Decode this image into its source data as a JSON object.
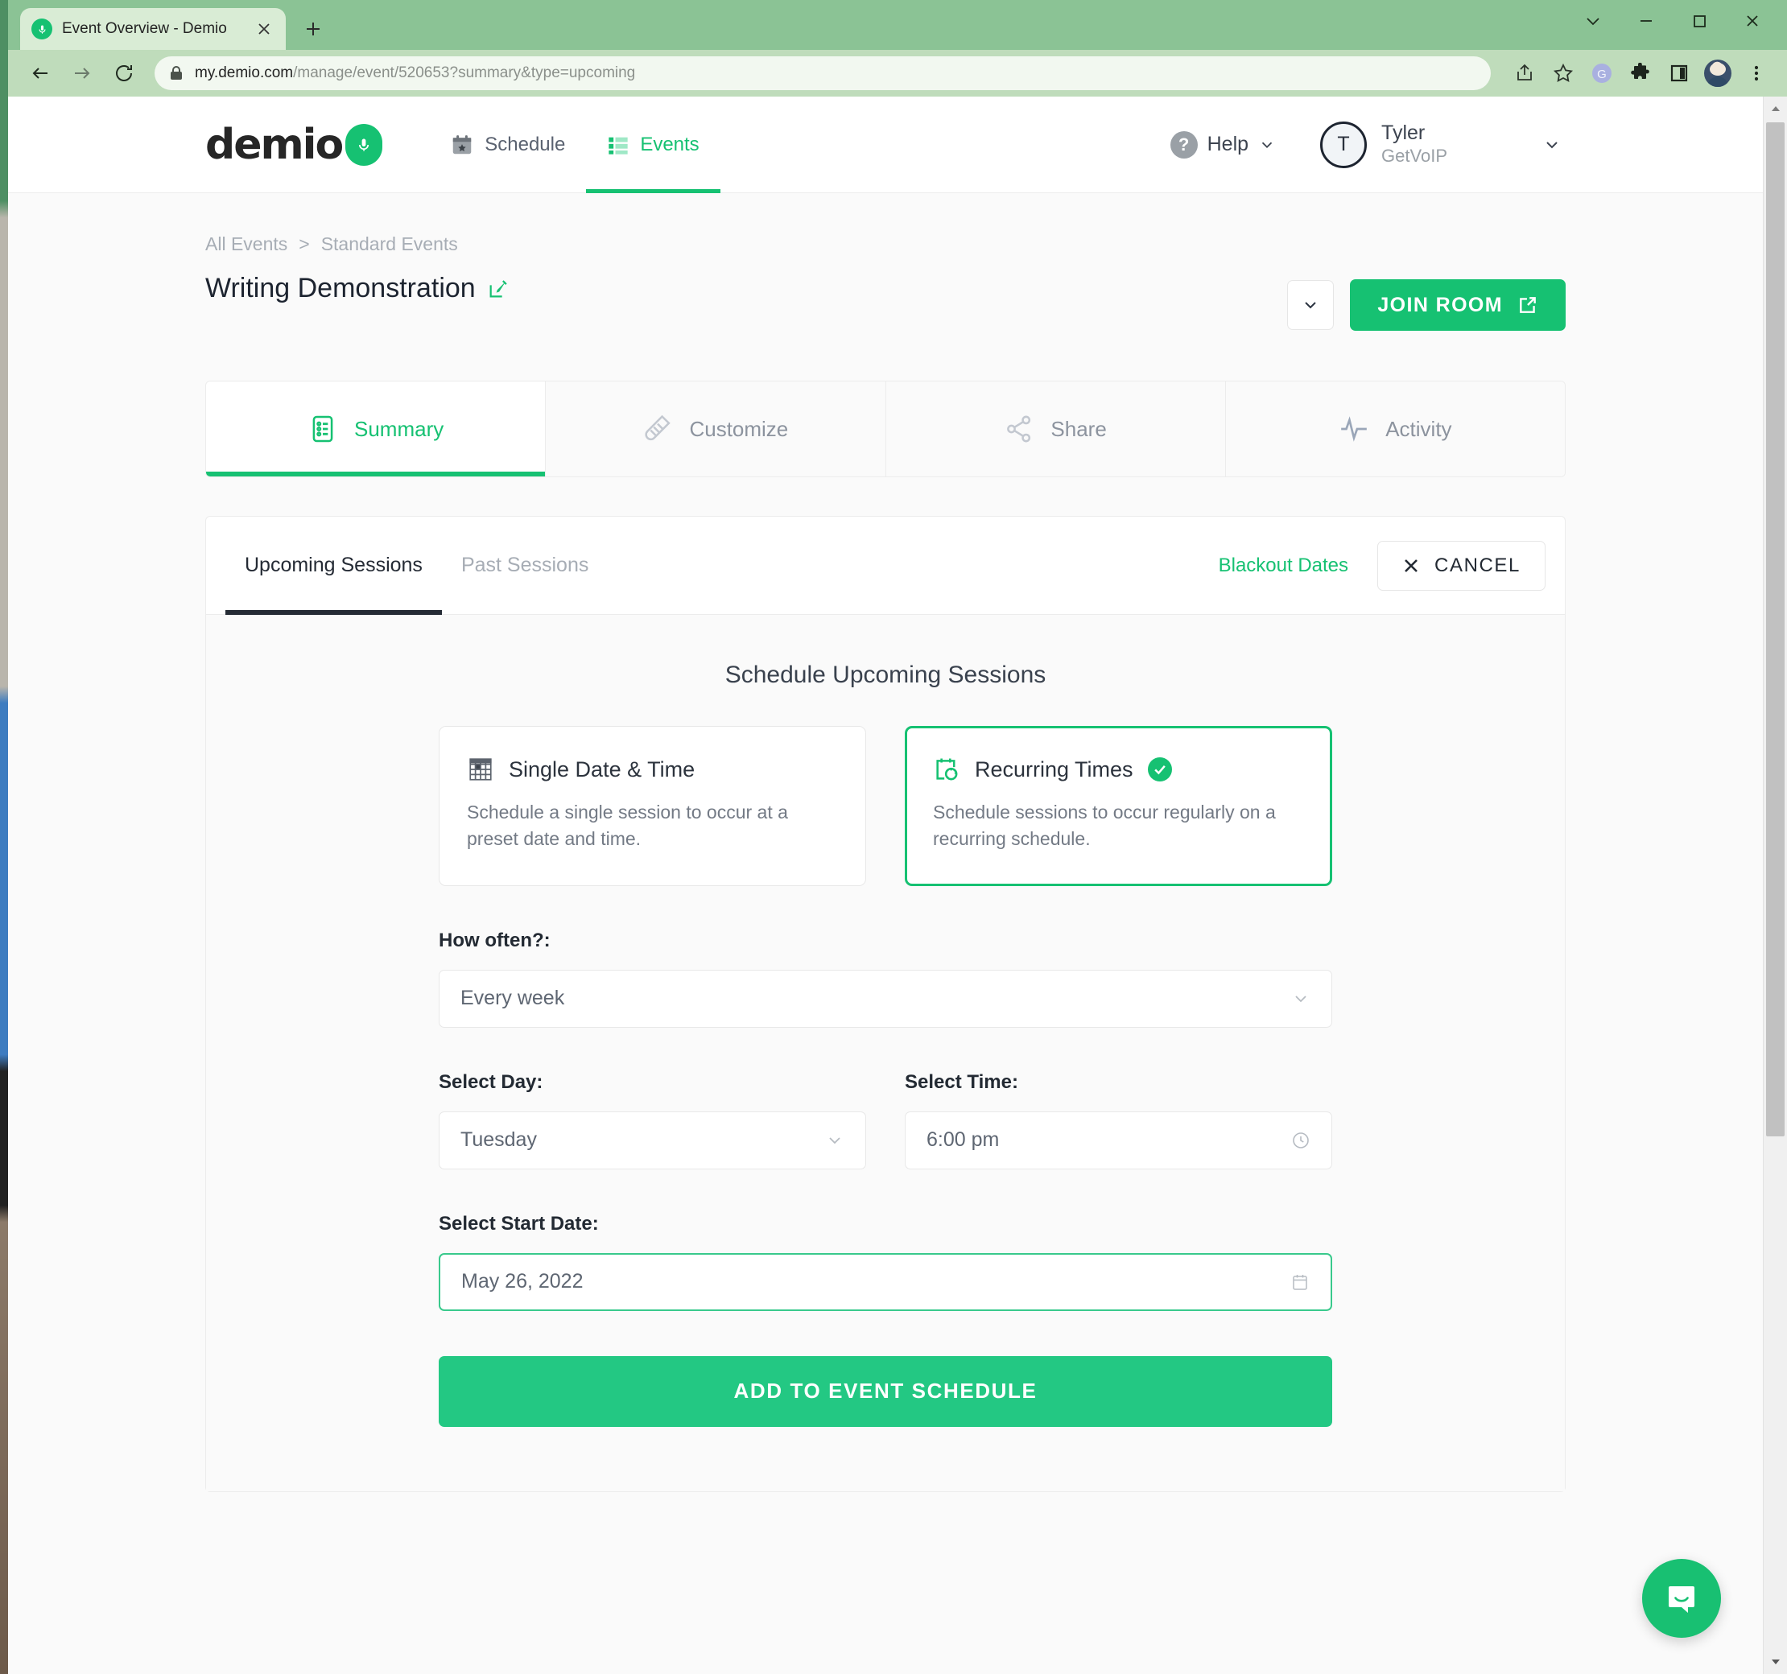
{
  "browser": {
    "tab": {
      "title": "Event Overview - Demio",
      "favicon": "demio-mic-icon",
      "close": "×"
    },
    "new_tab_label": "+",
    "url_main": "my.demio.com",
    "url_rest": "/manage/event/520653?summary&type=upcoming",
    "window_controls": {
      "minimize": "—",
      "maximize": "□",
      "close": "✕",
      "expand": "⌄"
    }
  },
  "app": {
    "logo_text": "demio",
    "nav": [
      {
        "label": "Schedule",
        "icon": "calendar-star-icon",
        "active": false
      },
      {
        "label": "Events",
        "icon": "list-icon",
        "active": true
      }
    ],
    "help_label": "Help",
    "help_badge": "?",
    "user": {
      "initial": "T",
      "name": "Tyler",
      "org": "GetVoIP"
    }
  },
  "breadcrumb": {
    "first": "All Events",
    "sep": ">",
    "second": "Standard Events"
  },
  "page_title": "Writing Demonstration",
  "actions": {
    "dropdown_caret": "⌄",
    "join_room": "JOIN ROOM"
  },
  "tabs": [
    {
      "label": "Summary",
      "icon": "summary-list-icon",
      "active": true
    },
    {
      "label": "Customize",
      "icon": "brush-icon",
      "active": false
    },
    {
      "label": "Share",
      "icon": "share-nodes-icon",
      "active": false
    },
    {
      "label": "Activity",
      "icon": "pulse-icon",
      "active": false
    }
  ],
  "panel": {
    "sub_tabs": [
      {
        "label": "Upcoming Sessions",
        "active": true
      },
      {
        "label": "Past Sessions",
        "active": false
      }
    ],
    "blackout_dates": "Blackout Dates",
    "cancel": "CANCEL",
    "section_title": "Schedule Upcoming Sessions",
    "choices": [
      {
        "title": "Single Date & Time",
        "desc": "Schedule a single session to occur at a preset date and time.",
        "icon": "calendar-grid-icon",
        "selected": false
      },
      {
        "title": "Recurring Times",
        "desc": "Schedule sessions to occur regularly on a recurring schedule.",
        "icon": "calendar-refresh-icon",
        "selected": true
      }
    ],
    "fields": {
      "how_often_label": "How often?:",
      "how_often_value": "Every week",
      "select_day_label": "Select Day:",
      "select_day_value": "Tuesday",
      "select_time_label": "Select Time:",
      "select_time_value": "6:00 pm",
      "start_date_label": "Select Start Date:",
      "start_date_value": "May 26, 2022"
    },
    "submit_label": "ADD TO EVENT SCHEDULE"
  },
  "intercom": {
    "icon": "chat-smile-icon"
  },
  "colors": {
    "brand_green": "#16c172",
    "submit_green": "#23c883",
    "chrome_green": "#8bc395",
    "toolbar_green": "#bfdcbb",
    "text_dark": "#1d2430",
    "text_muted": "#a7adb5"
  }
}
